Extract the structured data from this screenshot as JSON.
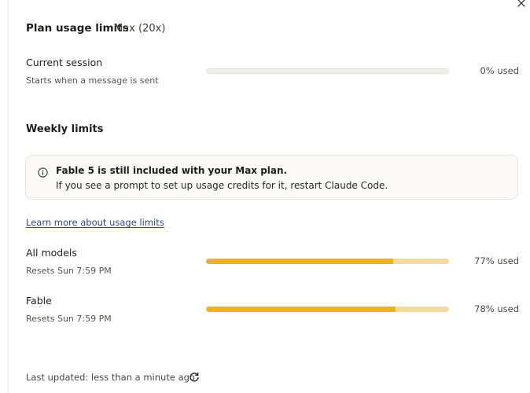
{
  "header": {
    "title": "Plan usage limits",
    "plan": "Max (20x)",
    "close_icon": "close-icon"
  },
  "current_session": {
    "label": "Current session",
    "sub": "Starts when a message is sent",
    "usage_fraction": 0.0,
    "pct_text": "0% used"
  },
  "weekly": {
    "title": "Weekly limits",
    "notice": {
      "icon": "info-icon",
      "line1": "Fable 5 is still included with your Max plan.",
      "line2": "If you see a prompt to set up usage credits for it, restart Claude Code."
    },
    "learn_more": "Learn more about usage limits",
    "rows": [
      {
        "label": "All models",
        "sub": "Resets Sun 7:59 PM",
        "usage_fraction": 0.77,
        "pct_text": "77% used"
      },
      {
        "label": "Fable",
        "sub": "Resets Sun 7:59 PM",
        "usage_fraction": 0.78,
        "pct_text": "78% used"
      }
    ]
  },
  "footer": {
    "updated": "Last updated: less than a minute ago",
    "refresh_icon": "refresh-icon"
  },
  "colors": {
    "bar_fill": "#f0b123",
    "bar_track_used": "#f3dba0",
    "bar_track_empty": "#efeeea",
    "link": "#2f4a86"
  }
}
